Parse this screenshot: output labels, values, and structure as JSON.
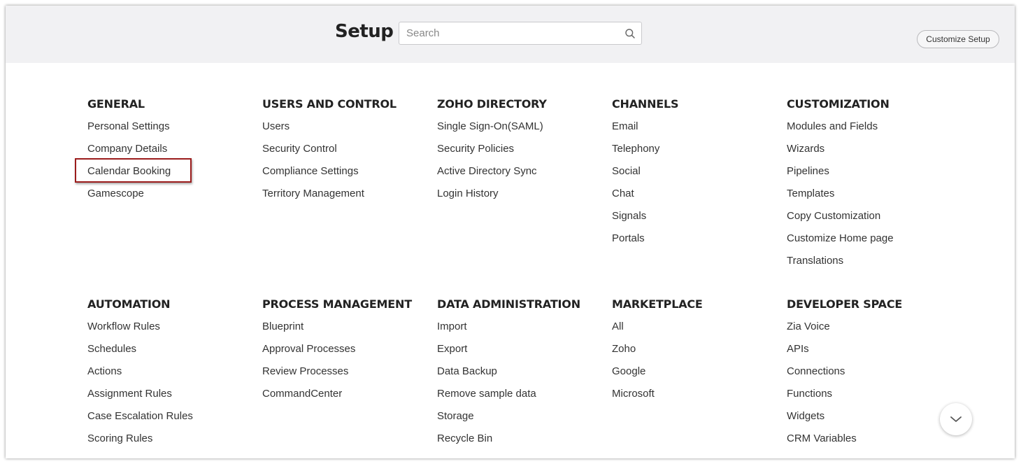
{
  "header": {
    "title": "Setup",
    "search_placeholder": "Search",
    "customize_label": "Customize Setup"
  },
  "sections": [
    {
      "heading": "GENERAL",
      "items": [
        "Personal Settings",
        "Company Details",
        "Calendar Booking",
        "Gamescope"
      ]
    },
    {
      "heading": "USERS AND CONTROL",
      "items": [
        "Users",
        "Security Control",
        "Compliance Settings",
        "Territory Management"
      ]
    },
    {
      "heading": "ZOHO DIRECTORY",
      "items": [
        "Single Sign-On(SAML)",
        "Security Policies",
        "Active Directory Sync",
        "Login History"
      ]
    },
    {
      "heading": "CHANNELS",
      "items": [
        "Email",
        "Telephony",
        "Social",
        "Chat",
        "Signals",
        "Portals"
      ]
    },
    {
      "heading": "CUSTOMIZATION",
      "items": [
        "Modules and Fields",
        "Wizards",
        "Pipelines",
        "Templates",
        "Copy Customization",
        "Customize Home page",
        "Translations"
      ]
    },
    {
      "heading": "AUTOMATION",
      "items": [
        "Workflow Rules",
        "Schedules",
        "Actions",
        "Assignment Rules",
        "Case Escalation Rules",
        "Scoring Rules"
      ]
    },
    {
      "heading": "PROCESS MANAGEMENT",
      "items": [
        "Blueprint",
        "Approval Processes",
        "Review Processes",
        "CommandCenter"
      ]
    },
    {
      "heading": "DATA ADMINISTRATION",
      "items": [
        "Import",
        "Export",
        "Data Backup",
        "Remove sample data",
        "Storage",
        "Recycle Bin"
      ]
    },
    {
      "heading": "MARKETPLACE",
      "items": [
        "All",
        "Zoho",
        "Google",
        "Microsoft"
      ]
    },
    {
      "heading": "DEVELOPER SPACE",
      "items": [
        "Zia Voice",
        "APIs",
        "Connections",
        "Functions",
        "Widgets",
        "CRM Variables"
      ]
    }
  ],
  "icons": {
    "search": "search-icon",
    "scroll": "chevron-down-icon"
  },
  "colors": {
    "header_bg": "#f1f1f3",
    "highlight_border": "#9b1c1c"
  }
}
